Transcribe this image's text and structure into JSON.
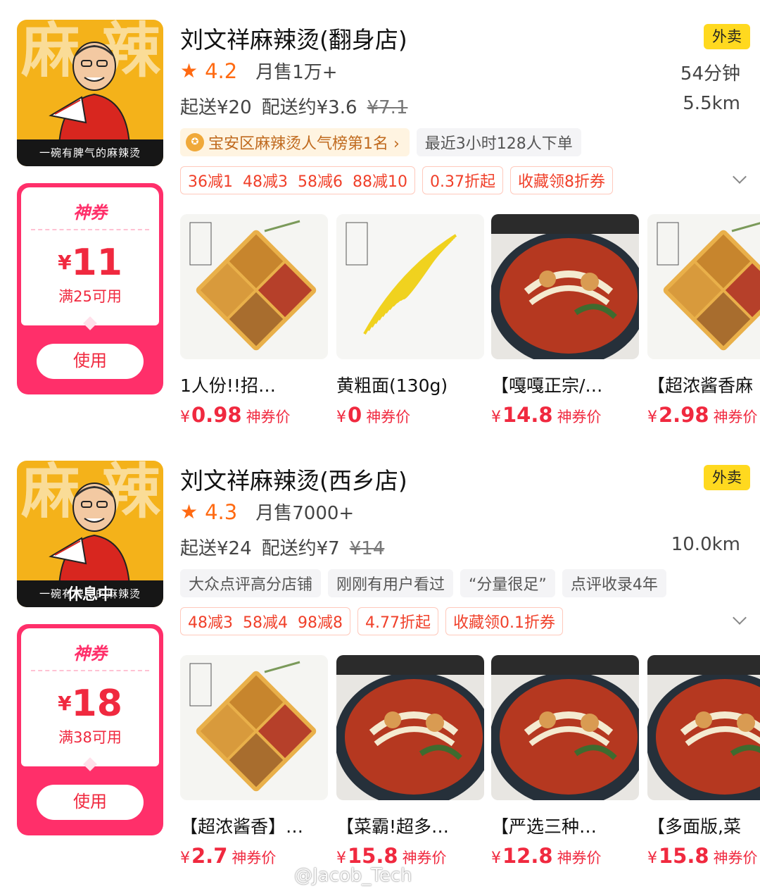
{
  "stores": [
    {
      "name": "刘文祥麻辣烫(翻身店)",
      "type_badge": "外卖",
      "rating": "4.2",
      "monthly_sales": "月售1万+",
      "eta": "54分钟",
      "min_order": "起送¥20",
      "delivery_fee": "配送约¥3.6",
      "delivery_fee_original": "¥7.1",
      "distance": "5.5km",
      "logo_slogan": "一碗有脾气的麻辣烫",
      "logo_chars": [
        "麻",
        "辣"
      ],
      "status": "",
      "tags": [
        {
          "kind": "rank",
          "text": "宝安区麻辣烫人气榜第1名 ›"
        },
        {
          "kind": "gray",
          "text": "最近3小时128人下单"
        }
      ],
      "promos": [
        {
          "parts": [
            "36减1",
            "48减3",
            "58减6",
            "88减10"
          ]
        },
        {
          "parts": [
            "0.37折起"
          ]
        },
        {
          "parts": [
            "收藏领8折券"
          ]
        }
      ],
      "coupon": {
        "label": "神券",
        "yen": "¥",
        "amount": "11",
        "condition": "满25可用",
        "button": "使用"
      },
      "items": [
        {
          "name": "1人份!!招…",
          "yen": "¥",
          "price": "0.98",
          "suffix": "神券价",
          "img": "sauce"
        },
        {
          "name": "黄粗面(130g)",
          "yen": "¥",
          "price": "0",
          "suffix": "神券价",
          "img": "noodle"
        },
        {
          "name": "【嘎嘎正宗/…",
          "yen": "¥",
          "price": "14.8",
          "suffix": "神券价",
          "img": "bowl"
        },
        {
          "name": "【超浓酱香麻",
          "yen": "¥",
          "price": "2.98",
          "suffix": "神券价",
          "img": "sauce"
        }
      ]
    },
    {
      "name": "刘文祥麻辣烫(西乡店)",
      "type_badge": "外卖",
      "rating": "4.3",
      "monthly_sales": "月售7000+",
      "eta": "",
      "min_order": "起送¥24",
      "delivery_fee": "配送约¥7",
      "delivery_fee_original": "¥14",
      "distance": "10.0km",
      "logo_slogan": "一碗有脾气的麻辣烫",
      "logo_chars": [
        "麻",
        "辣"
      ],
      "status": "休息中",
      "tags": [
        {
          "kind": "gray",
          "text": "大众点评高分店铺"
        },
        {
          "kind": "gray",
          "text": "刚刚有用户看过"
        },
        {
          "kind": "gray",
          "text": "“分量很足”"
        },
        {
          "kind": "gray",
          "text": "点评收录4年"
        }
      ],
      "promos": [
        {
          "parts": [
            "48减3",
            "58减4",
            "98减8"
          ]
        },
        {
          "parts": [
            "4.77折起"
          ]
        },
        {
          "parts": [
            "收藏领0.1折券"
          ]
        }
      ],
      "coupon": {
        "label": "神券",
        "yen": "¥",
        "amount": "18",
        "condition": "满38可用",
        "button": "使用"
      },
      "items": [
        {
          "name": "【超浓酱香】…",
          "yen": "¥",
          "price": "2.7",
          "suffix": "神券价",
          "img": "sauce"
        },
        {
          "name": "【菜霸!超多…",
          "yen": "¥",
          "price": "15.8",
          "suffix": "神券价",
          "img": "bowl"
        },
        {
          "name": "【严选三种…",
          "yen": "¥",
          "price": "12.8",
          "suffix": "神券价",
          "img": "bowl"
        },
        {
          "name": "【多面版,菜",
          "yen": "¥",
          "price": "15.8",
          "suffix": "神券价",
          "img": "bowl"
        }
      ]
    }
  ],
  "watermark": "@Jacob_Tech",
  "colors": {
    "accent": "#ff6a12",
    "price": "#f0293f",
    "coupon": "#ff2f6a",
    "badge": "#ffd91f"
  }
}
